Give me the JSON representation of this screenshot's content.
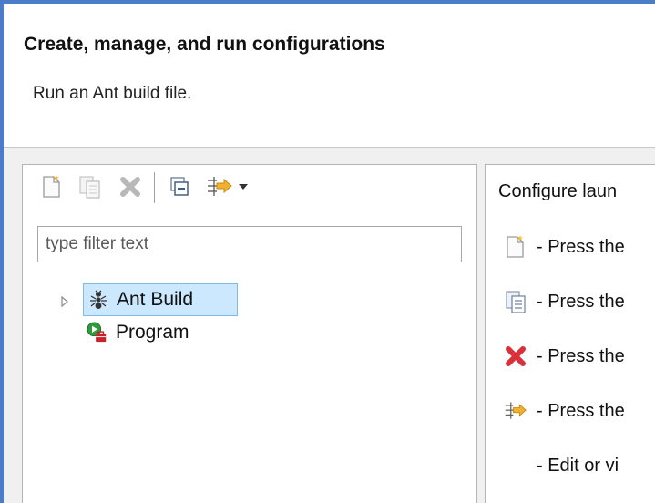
{
  "header": {
    "title": "Create, manage, and run configurations",
    "description": "Run an Ant build file."
  },
  "toolbar": {
    "buttons": [
      {
        "name": "new-configuration",
        "icon": "new-config-icon",
        "enabled": false
      },
      {
        "name": "duplicate",
        "icon": "duplicate-icon",
        "enabled": false
      },
      {
        "name": "delete",
        "icon": "delete-icon",
        "enabled": false
      },
      {
        "name": "collapse-all",
        "icon": "collapse-all-icon",
        "enabled": true
      },
      {
        "name": "filter",
        "icon": "filter-icon",
        "enabled": true
      },
      {
        "name": "view-menu",
        "icon": "dropdown-arrow-icon",
        "enabled": true
      }
    ]
  },
  "filter": {
    "placeholder": "type filter text",
    "value": ""
  },
  "tree": {
    "items": [
      {
        "label": "Ant Build",
        "icon": "ant-icon",
        "expandable": true,
        "selected": true
      },
      {
        "label": "Program",
        "icon": "program-icon",
        "expandable": false,
        "selected": false
      }
    ]
  },
  "right_pane": {
    "heading": "Configure laun",
    "rows": [
      {
        "icon": "new-config-icon",
        "text": "- Press the"
      },
      {
        "icon": "duplicate-icon",
        "text": "- Press the"
      },
      {
        "icon": "delete-icon",
        "text": "- Press the"
      },
      {
        "icon": "filter-icon",
        "text": "- Press the"
      },
      {
        "icon": "",
        "text": "- Edit or vi"
      }
    ]
  },
  "colors": {
    "window_border": "#4a7cc9",
    "selection_bg": "#cce8ff",
    "selection_border": "#7fbbe6",
    "delete_red": "#d9303a",
    "filter_orange": "#f0b030"
  }
}
